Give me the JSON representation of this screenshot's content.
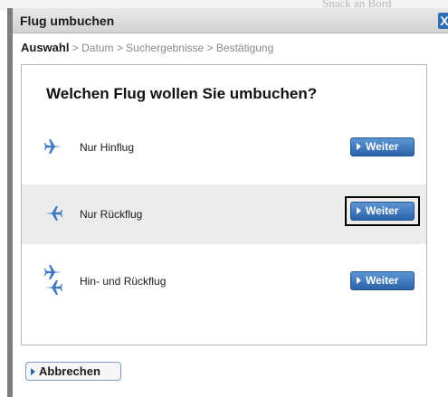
{
  "background": {
    "text": "Snack an Bord"
  },
  "dialog": {
    "title": "Flug umbuchen",
    "close_label": "X"
  },
  "breadcrumb": {
    "active": "Auswahl",
    "rest": " > Datum > Suchergebnisse > Bestätigung"
  },
  "question": "Welchen Flug wollen Sie umbuchen?",
  "options": [
    {
      "label": "Nur Hinflug",
      "icon": "plane-right-icon",
      "button": "Weiter",
      "selected": false
    },
    {
      "label": "Nur Rückflug",
      "icon": "plane-left-icon",
      "button": "Weiter",
      "selected": true
    },
    {
      "label": "Hin- und Rückflug",
      "icon": "plane-both-icon",
      "button": "Weiter",
      "selected": false
    }
  ],
  "cancel_label": "Abbrechen",
  "colors": {
    "accent": "#2c63a9",
    "plane": "#3d79c1",
    "selected_row": "#ececec"
  }
}
